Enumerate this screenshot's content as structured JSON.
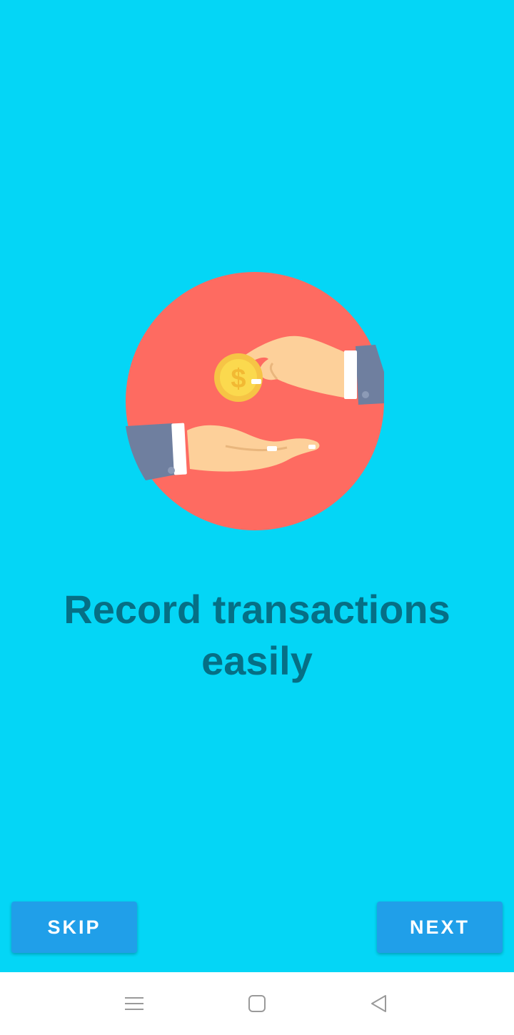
{
  "onboarding": {
    "illustration": "hand-giving-coin-illustration",
    "headline": "Record transactions easily",
    "background_color": "#04d6f6",
    "headline_color": "#066f85"
  },
  "buttons": {
    "skip_label": "SKIP",
    "next_label": "NEXT",
    "color": "#209fe9"
  },
  "system_nav": {
    "icons": [
      "menu-icon",
      "home-icon",
      "back-icon"
    ]
  }
}
